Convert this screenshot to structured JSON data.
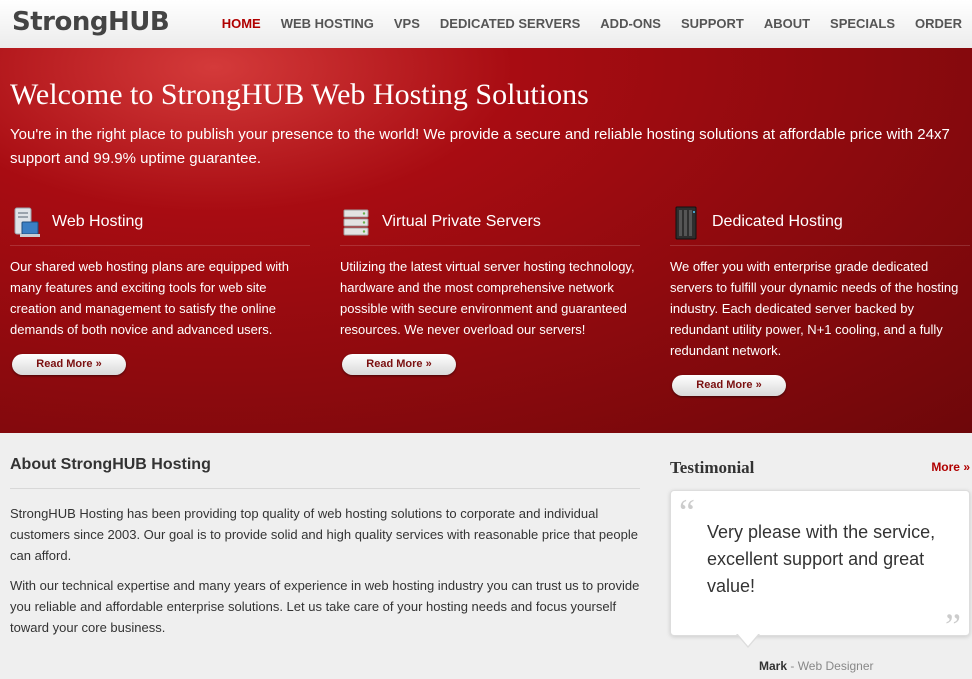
{
  "header": {
    "logo": "StrongHUB",
    "nav": [
      {
        "label": "HOME",
        "active": true
      },
      {
        "label": "WEB HOSTING",
        "active": false
      },
      {
        "label": "VPS",
        "active": false
      },
      {
        "label": "DEDICATED SERVERS",
        "active": false
      },
      {
        "label": "ADD-ONS",
        "active": false
      },
      {
        "label": "SUPPORT",
        "active": false
      },
      {
        "label": "ABOUT",
        "active": false
      },
      {
        "label": "SPECIALS",
        "active": false
      },
      {
        "label": "ORDER",
        "active": false
      }
    ]
  },
  "hero": {
    "title": "Welcome to StrongHUB Web Hosting Solutions",
    "subtitle": "You're in the right place to publish your presence to the world! We provide a secure and reliable hosting solutions at affordable price with 24x7 support and 99.9% uptime guarantee.",
    "features": [
      {
        "icon": "web-hosting-icon",
        "title": "Web Hosting",
        "text": "Our shared web hosting plans are equipped with many features and exciting tools for web site creation and management to satisfy the online demands of both novice and advanced users.",
        "button": "Read More »"
      },
      {
        "icon": "server-stack-icon",
        "title": "Virtual Private Servers",
        "text": "Utilizing the latest virtual server hosting technology, hardware and the most comprehensive network possible with secure environment and guaranteed resources. We never overload our servers!",
        "button": "Read More »"
      },
      {
        "icon": "server-rack-icon",
        "title": "Dedicated Hosting",
        "text": "We offer you with enterprise grade dedicated servers to fulfill your dynamic needs of the hosting industry. Each dedicated server backed by redundant utility power, N+1 cooling, and a fully redundant network.",
        "button": "Read More »"
      }
    ]
  },
  "about": {
    "title": "About StrongHUB Hosting",
    "paragraphs": [
      "StrongHUB Hosting has been providing top quality of web hosting solutions to corporate and individual customers since 2003. Our goal is to provide solid and high quality services with reasonable price that people can afford.",
      "With our technical expertise and many years of experience in web hosting industry you can trust us to provide you reliable and affordable enterprise solutions. Let us take care of your hosting needs and focus yourself toward your core business."
    ]
  },
  "testimonial": {
    "title": "Testimonial",
    "more": "More »",
    "quote": "Very please with the service, excellent support and great value!",
    "open_mark": "“",
    "close_mark": "”",
    "author": "Mark",
    "separator": " - ",
    "role": "Web Designer"
  },
  "colors": {
    "accent": "#b00000",
    "hero": "#9a0b10"
  }
}
